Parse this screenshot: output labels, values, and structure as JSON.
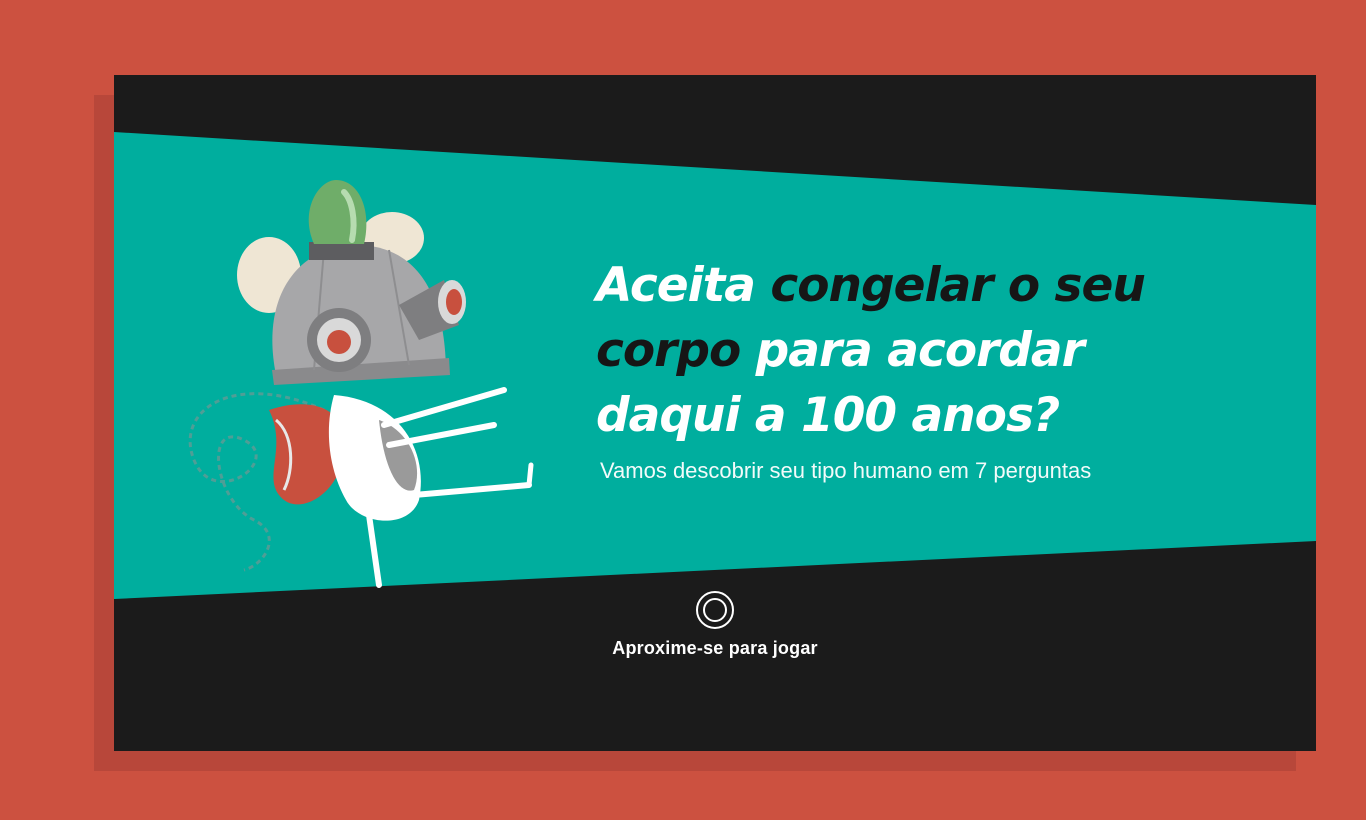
{
  "headline": {
    "part1": "Aceita ",
    "part2": "congelar o seu corpo",
    "part3": " para acordar daqui a 100 anos?"
  },
  "subtitle": "Vamos descobrir seu tipo humano em 7 perguntas",
  "cta": {
    "icon": "target-circle-icon",
    "label": "Aproxime-se para jogar"
  },
  "illustration": {
    "icon": "cryo-mouse-mascot-icon"
  },
  "colors": {
    "background": "#cc5140",
    "screen": "#1b1b1b",
    "band": "#00ae9e",
    "text_light": "#ffffff",
    "text_dark": "#161616"
  }
}
